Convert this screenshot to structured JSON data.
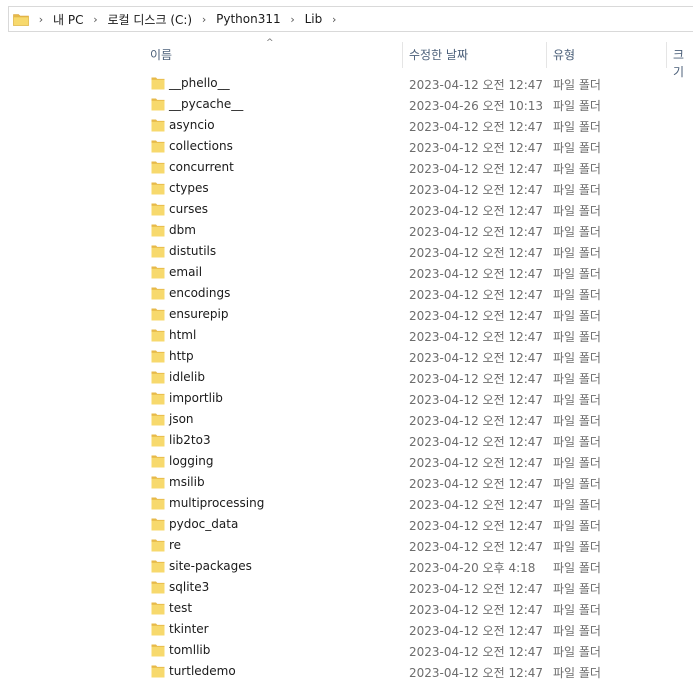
{
  "address": {
    "crumbs": [
      "내 PC",
      "로컬 디스크 (C:)",
      "Python311",
      "Lib"
    ],
    "separator": "›"
  },
  "columns": {
    "sort_arrow": "^",
    "name": "이름",
    "date": "수정한 날짜",
    "type": "유형",
    "size": "크기"
  },
  "colors": {
    "folder": "#f7d96d",
    "folder_dark": "#e7b94a",
    "header_text": "#4c607a"
  },
  "files": [
    {
      "name": "__phello__",
      "date": "2023-04-12 오전 12:47",
      "type": "파일 폴더"
    },
    {
      "name": "__pycache__",
      "date": "2023-04-26 오전 10:13",
      "type": "파일 폴더"
    },
    {
      "name": "asyncio",
      "date": "2023-04-12 오전 12:47",
      "type": "파일 폴더"
    },
    {
      "name": "collections",
      "date": "2023-04-12 오전 12:47",
      "type": "파일 폴더"
    },
    {
      "name": "concurrent",
      "date": "2023-04-12 오전 12:47",
      "type": "파일 폴더"
    },
    {
      "name": "ctypes",
      "date": "2023-04-12 오전 12:47",
      "type": "파일 폴더"
    },
    {
      "name": "curses",
      "date": "2023-04-12 오전 12:47",
      "type": "파일 폴더"
    },
    {
      "name": "dbm",
      "date": "2023-04-12 오전 12:47",
      "type": "파일 폴더"
    },
    {
      "name": "distutils",
      "date": "2023-04-12 오전 12:47",
      "type": "파일 폴더"
    },
    {
      "name": "email",
      "date": "2023-04-12 오전 12:47",
      "type": "파일 폴더"
    },
    {
      "name": "encodings",
      "date": "2023-04-12 오전 12:47",
      "type": "파일 폴더"
    },
    {
      "name": "ensurepip",
      "date": "2023-04-12 오전 12:47",
      "type": "파일 폴더"
    },
    {
      "name": "html",
      "date": "2023-04-12 오전 12:47",
      "type": "파일 폴더"
    },
    {
      "name": "http",
      "date": "2023-04-12 오전 12:47",
      "type": "파일 폴더"
    },
    {
      "name": "idlelib",
      "date": "2023-04-12 오전 12:47",
      "type": "파일 폴더"
    },
    {
      "name": "importlib",
      "date": "2023-04-12 오전 12:47",
      "type": "파일 폴더"
    },
    {
      "name": "json",
      "date": "2023-04-12 오전 12:47",
      "type": "파일 폴더"
    },
    {
      "name": "lib2to3",
      "date": "2023-04-12 오전 12:47",
      "type": "파일 폴더"
    },
    {
      "name": "logging",
      "date": "2023-04-12 오전 12:47",
      "type": "파일 폴더"
    },
    {
      "name": "msilib",
      "date": "2023-04-12 오전 12:47",
      "type": "파일 폴더"
    },
    {
      "name": "multiprocessing",
      "date": "2023-04-12 오전 12:47",
      "type": "파일 폴더"
    },
    {
      "name": "pydoc_data",
      "date": "2023-04-12 오전 12:47",
      "type": "파일 폴더"
    },
    {
      "name": "re",
      "date": "2023-04-12 오전 12:47",
      "type": "파일 폴더"
    },
    {
      "name": "site-packages",
      "date": "2023-04-20 오후 4:18",
      "type": "파일 폴더"
    },
    {
      "name": "sqlite3",
      "date": "2023-04-12 오전 12:47",
      "type": "파일 폴더"
    },
    {
      "name": "test",
      "date": "2023-04-12 오전 12:47",
      "type": "파일 폴더"
    },
    {
      "name": "tkinter",
      "date": "2023-04-12 오전 12:47",
      "type": "파일 폴더"
    },
    {
      "name": "tomllib",
      "date": "2023-04-12 오전 12:47",
      "type": "파일 폴더"
    },
    {
      "name": "turtledemo",
      "date": "2023-04-12 오전 12:47",
      "type": "파일 폴더"
    }
  ]
}
